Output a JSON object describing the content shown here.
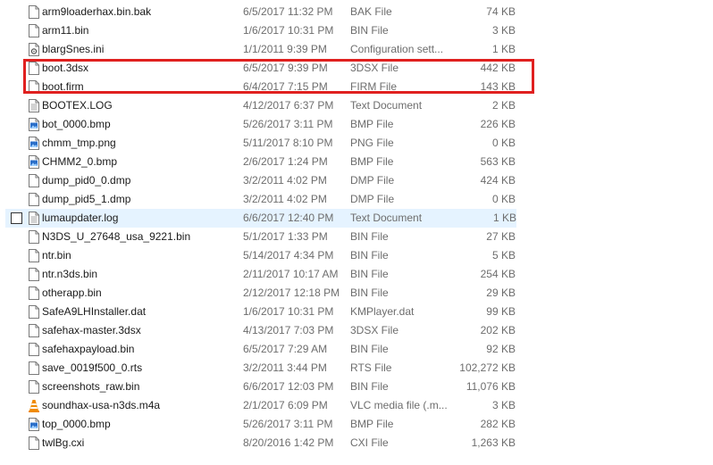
{
  "files": [
    {
      "name": "arm9loaderhax.bin.bak",
      "date": "6/5/2017 11:32 PM",
      "type": "BAK File",
      "size": "74 KB",
      "icon": "generic-file-icon"
    },
    {
      "name": "arm11.bin",
      "date": "1/6/2017 10:31 PM",
      "type": "BIN File",
      "size": "3 KB",
      "icon": "generic-file-icon"
    },
    {
      "name": "blargSnes.ini",
      "date": "1/1/2011 9:39 PM",
      "type": "Configuration sett...",
      "size": "1 KB",
      "icon": "config-file-icon"
    },
    {
      "name": "boot.3dsx",
      "date": "6/5/2017 9:39 PM",
      "type": "3DSX File",
      "size": "442 KB",
      "icon": "generic-file-icon"
    },
    {
      "name": "boot.firm",
      "date": "6/4/2017 7:15 PM",
      "type": "FIRM File",
      "size": "143 KB",
      "icon": "generic-file-icon"
    },
    {
      "name": "BOOTEX.LOG",
      "date": "4/12/2017 6:37 PM",
      "type": "Text Document",
      "size": "2 KB",
      "icon": "text-document-icon"
    },
    {
      "name": "bot_0000.bmp",
      "date": "5/26/2017 3:11 PM",
      "type": "BMP File",
      "size": "226 KB",
      "icon": "image-file-icon"
    },
    {
      "name": "chmm_tmp.png",
      "date": "5/11/2017 8:10 PM",
      "type": "PNG File",
      "size": "0 KB",
      "icon": "image-file-icon"
    },
    {
      "name": "CHMM2_0.bmp",
      "date": "2/6/2017 1:24 PM",
      "type": "BMP File",
      "size": "563 KB",
      "icon": "image-file-icon"
    },
    {
      "name": "dump_pid0_0.dmp",
      "date": "3/2/2011 4:02 PM",
      "type": "DMP File",
      "size": "424 KB",
      "icon": "generic-file-icon"
    },
    {
      "name": "dump_pid5_1.dmp",
      "date": "3/2/2011 4:02 PM",
      "type": "DMP File",
      "size": "0 KB",
      "icon": "generic-file-icon"
    },
    {
      "name": "lumaupdater.log",
      "date": "6/6/2017 12:40 PM",
      "type": "Text Document",
      "size": "1 KB",
      "icon": "text-document-icon",
      "hover": true
    },
    {
      "name": "N3DS_U_27648_usa_9221.bin",
      "date": "5/1/2017 1:33 PM",
      "type": "BIN File",
      "size": "27 KB",
      "icon": "generic-file-icon"
    },
    {
      "name": "ntr.bin",
      "date": "5/14/2017 4:34 PM",
      "type": "BIN File",
      "size": "5 KB",
      "icon": "generic-file-icon"
    },
    {
      "name": "ntr.n3ds.bin",
      "date": "2/11/2017 10:17 AM",
      "type": "BIN File",
      "size": "254 KB",
      "icon": "generic-file-icon"
    },
    {
      "name": "otherapp.bin",
      "date": "2/12/2017 12:18 PM",
      "type": "BIN File",
      "size": "29 KB",
      "icon": "generic-file-icon"
    },
    {
      "name": "SafeA9LHInstaller.dat",
      "date": "1/6/2017 10:31 PM",
      "type": "KMPlayer.dat",
      "size": "99 KB",
      "icon": "generic-file-icon"
    },
    {
      "name": "safehax-master.3dsx",
      "date": "4/13/2017 7:03 PM",
      "type": "3DSX File",
      "size": "202 KB",
      "icon": "generic-file-icon"
    },
    {
      "name": "safehaxpayload.bin",
      "date": "6/5/2017 7:29 AM",
      "type": "BIN File",
      "size": "92 KB",
      "icon": "generic-file-icon"
    },
    {
      "name": "save_0019f500_0.rts",
      "date": "3/2/2011 3:44 PM",
      "type": "RTS File",
      "size": "102,272 KB",
      "icon": "generic-file-icon"
    },
    {
      "name": "screenshots_raw.bin",
      "date": "6/6/2017 12:03 PM",
      "type": "BIN File",
      "size": "11,076 KB",
      "icon": "generic-file-icon"
    },
    {
      "name": "soundhax-usa-n3ds.m4a",
      "date": "2/1/2017 6:09 PM",
      "type": "VLC media file (.m...",
      "size": "3 KB",
      "icon": "vlc-cone-icon"
    },
    {
      "name": "top_0000.bmp",
      "date": "5/26/2017 3:11 PM",
      "type": "BMP File",
      "size": "282 KB",
      "icon": "image-file-icon"
    },
    {
      "name": "twlBg.cxi",
      "date": "8/20/2016 1:42 PM",
      "type": "CXI File",
      "size": "1,263 KB",
      "icon": "generic-file-icon"
    }
  ],
  "colors": {
    "highlight_border": "#e0201f",
    "hover_row": "#e5f3ff",
    "secondary_text": "#6d6d6d"
  }
}
